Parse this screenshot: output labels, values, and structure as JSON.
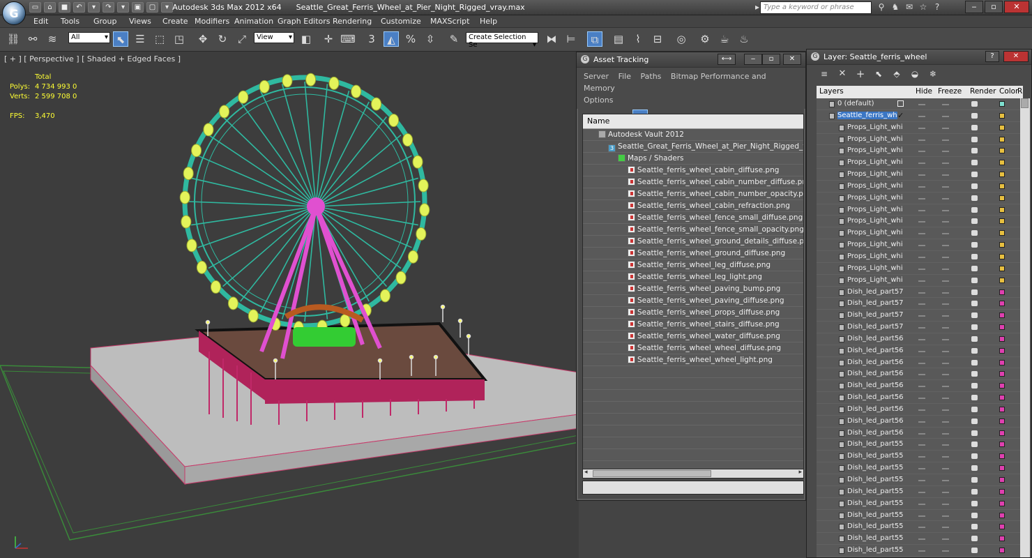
{
  "window": {
    "app_title": "Autodesk 3ds Max  2012 x64",
    "file_title": "Seattle_Great_Ferris_Wheel_at_Pier_Night_Rigged_vray.max",
    "search_placeholder": "Type a keyword or phrase"
  },
  "menu": [
    "Edit",
    "Tools",
    "Group",
    "Views",
    "Create",
    "Modifiers",
    "Animation",
    "Graph Editors",
    "Rendering",
    "Customize",
    "MAXScript",
    "Help"
  ],
  "toolbar": {
    "filter_value": "All",
    "coord_value": "View",
    "selection_set_value": "Create Selection Se"
  },
  "viewport": {
    "label": "[ + ] [ Perspective ] [ Shaded + Edged Faces ]",
    "stats": {
      "total_label": "Total",
      "polys_label": "Polys:",
      "polys_value": "4 734 993",
      "polys_sel": "0",
      "verts_label": "Verts:",
      "verts_value": "2 599 708",
      "verts_sel": "0",
      "fps_label": "FPS:",
      "fps_value": "3,470"
    }
  },
  "asset_tracking": {
    "title": "Asset Tracking",
    "menu": [
      "Server",
      "File",
      "Paths",
      "Bitmap Performance and Memory",
      "Options"
    ],
    "column": "Name",
    "tree": [
      {
        "name": "Autodesk Vault 2012",
        "indent": 0,
        "icon": "vault"
      },
      {
        "name": "Seattle_Great_Ferris_Wheel_at_Pier_Night_Rigged_vray....",
        "indent": 1,
        "icon": "max"
      },
      {
        "name": "Maps / Shaders",
        "indent": 2,
        "icon": "map"
      },
      {
        "name": "Seattle_ferris_wheel_cabin_diffuse.png",
        "indent": 3,
        "icon": "png"
      },
      {
        "name": "Seattle_ferris_wheel_cabin_number_diffuse.png",
        "indent": 3,
        "icon": "png"
      },
      {
        "name": "Seattle_ferris_wheel_cabin_number_opacity.png",
        "indent": 3,
        "icon": "png"
      },
      {
        "name": "Seattle_ferris_wheel_cabin_refraction.png",
        "indent": 3,
        "icon": "png"
      },
      {
        "name": "Seattle_ferris_wheel_fence_small_diffuse.png",
        "indent": 3,
        "icon": "png"
      },
      {
        "name": "Seattle_ferris_wheel_fence_small_opacity.png",
        "indent": 3,
        "icon": "png"
      },
      {
        "name": "Seattle_ferris_wheel_ground_details_diffuse.png",
        "indent": 3,
        "icon": "png"
      },
      {
        "name": "Seattle_ferris_wheel_ground_diffuse.png",
        "indent": 3,
        "icon": "png"
      },
      {
        "name": "Seattle_ferris_wheel_leg_diffuse.png",
        "indent": 3,
        "icon": "png"
      },
      {
        "name": "Seattle_ferris_wheel_leg_light.png",
        "indent": 3,
        "icon": "png"
      },
      {
        "name": "Seattle_ferris_wheel_paving_bump.png",
        "indent": 3,
        "icon": "png"
      },
      {
        "name": "Seattle_ferris_wheel_paving_diffuse.png",
        "indent": 3,
        "icon": "png"
      },
      {
        "name": "Seattle_ferris_wheel_props_diffuse.png",
        "indent": 3,
        "icon": "png"
      },
      {
        "name": "Seattle_ferris_wheel_stairs_diffuse.png",
        "indent": 3,
        "icon": "png"
      },
      {
        "name": "Seattle_ferris_wheel_water_diffuse.png",
        "indent": 3,
        "icon": "png"
      },
      {
        "name": "Seattle_ferris_wheel_wheel_diffuse.png",
        "indent": 3,
        "icon": "png"
      },
      {
        "name": "Seattle_ferris_wheel_wheel_light.png",
        "indent": 3,
        "icon": "png"
      }
    ],
    "empty_rows": 11
  },
  "layer_panel": {
    "title": "Layer: Seattle_ferris_wheel",
    "headers": {
      "layers": "Layers",
      "hide": "Hide",
      "freeze": "Freeze",
      "render": "Render",
      "color": "Color",
      "extra": "R"
    },
    "rows": [
      {
        "name": "0 (default)",
        "level": 0,
        "color": "#7fe0d0",
        "selected": false,
        "current": true
      },
      {
        "name": "Seattle_ferris_wheel",
        "level": 0,
        "color": "#e8c040",
        "selected": true,
        "current": false
      },
      {
        "name": "Props_Light_whi",
        "level": 1,
        "color": "#e8c040"
      },
      {
        "name": "Props_Light_whi",
        "level": 1,
        "color": "#e8c040"
      },
      {
        "name": "Props_Light_whi",
        "level": 1,
        "color": "#e8c040"
      },
      {
        "name": "Props_Light_whi",
        "level": 1,
        "color": "#e8c040"
      },
      {
        "name": "Props_Light_whi",
        "level": 1,
        "color": "#e8c040"
      },
      {
        "name": "Props_Light_whi",
        "level": 1,
        "color": "#e8c040"
      },
      {
        "name": "Props_Light_whi",
        "level": 1,
        "color": "#e8c040"
      },
      {
        "name": "Props_Light_whi",
        "level": 1,
        "color": "#e8c040"
      },
      {
        "name": "Props_Light_whi",
        "level": 1,
        "color": "#e8c040"
      },
      {
        "name": "Props_Light_whi",
        "level": 1,
        "color": "#e8c040"
      },
      {
        "name": "Props_Light_whi",
        "level": 1,
        "color": "#e8c040"
      },
      {
        "name": "Props_Light_whi",
        "level": 1,
        "color": "#e8c040"
      },
      {
        "name": "Props_Light_whi",
        "level": 1,
        "color": "#e8c040"
      },
      {
        "name": "Props_Light_whi",
        "level": 1,
        "color": "#e8c040"
      },
      {
        "name": "Dish_led_part57",
        "level": 1,
        "color": "#e040b0"
      },
      {
        "name": "Dish_led_part57",
        "level": 1,
        "color": "#e040b0"
      },
      {
        "name": "Dish_led_part57",
        "level": 1,
        "color": "#e040b0"
      },
      {
        "name": "Dish_led_part57",
        "level": 1,
        "color": "#e040b0"
      },
      {
        "name": "Dish_led_part56",
        "level": 1,
        "color": "#e040b0"
      },
      {
        "name": "Dish_led_part56",
        "level": 1,
        "color": "#e040b0"
      },
      {
        "name": "Dish_led_part56",
        "level": 1,
        "color": "#e040b0"
      },
      {
        "name": "Dish_led_part56",
        "level": 1,
        "color": "#e040b0"
      },
      {
        "name": "Dish_led_part56",
        "level": 1,
        "color": "#e040b0"
      },
      {
        "name": "Dish_led_part56",
        "level": 1,
        "color": "#e040b0"
      },
      {
        "name": "Dish_led_part56",
        "level": 1,
        "color": "#e040b0"
      },
      {
        "name": "Dish_led_part56",
        "level": 1,
        "color": "#e040b0"
      },
      {
        "name": "Dish_led_part56",
        "level": 1,
        "color": "#e040b0"
      },
      {
        "name": "Dish_led_part55",
        "level": 1,
        "color": "#e040b0"
      },
      {
        "name": "Dish_led_part55",
        "level": 1,
        "color": "#e040b0"
      },
      {
        "name": "Dish_led_part55",
        "level": 1,
        "color": "#e040b0"
      },
      {
        "name": "Dish_led_part55",
        "level": 1,
        "color": "#e040b0"
      },
      {
        "name": "Dish_led_part55",
        "level": 1,
        "color": "#e040b0"
      },
      {
        "name": "Dish_led_part55",
        "level": 1,
        "color": "#e040b0"
      },
      {
        "name": "Dish_led_part55",
        "level": 1,
        "color": "#e040b0"
      },
      {
        "name": "Dish_led_part55",
        "level": 1,
        "color": "#e040b0"
      },
      {
        "name": "Dish_led_part55",
        "level": 1,
        "color": "#e040b0"
      },
      {
        "name": "Dish_led_part55",
        "level": 1,
        "color": "#e040b0"
      }
    ]
  }
}
